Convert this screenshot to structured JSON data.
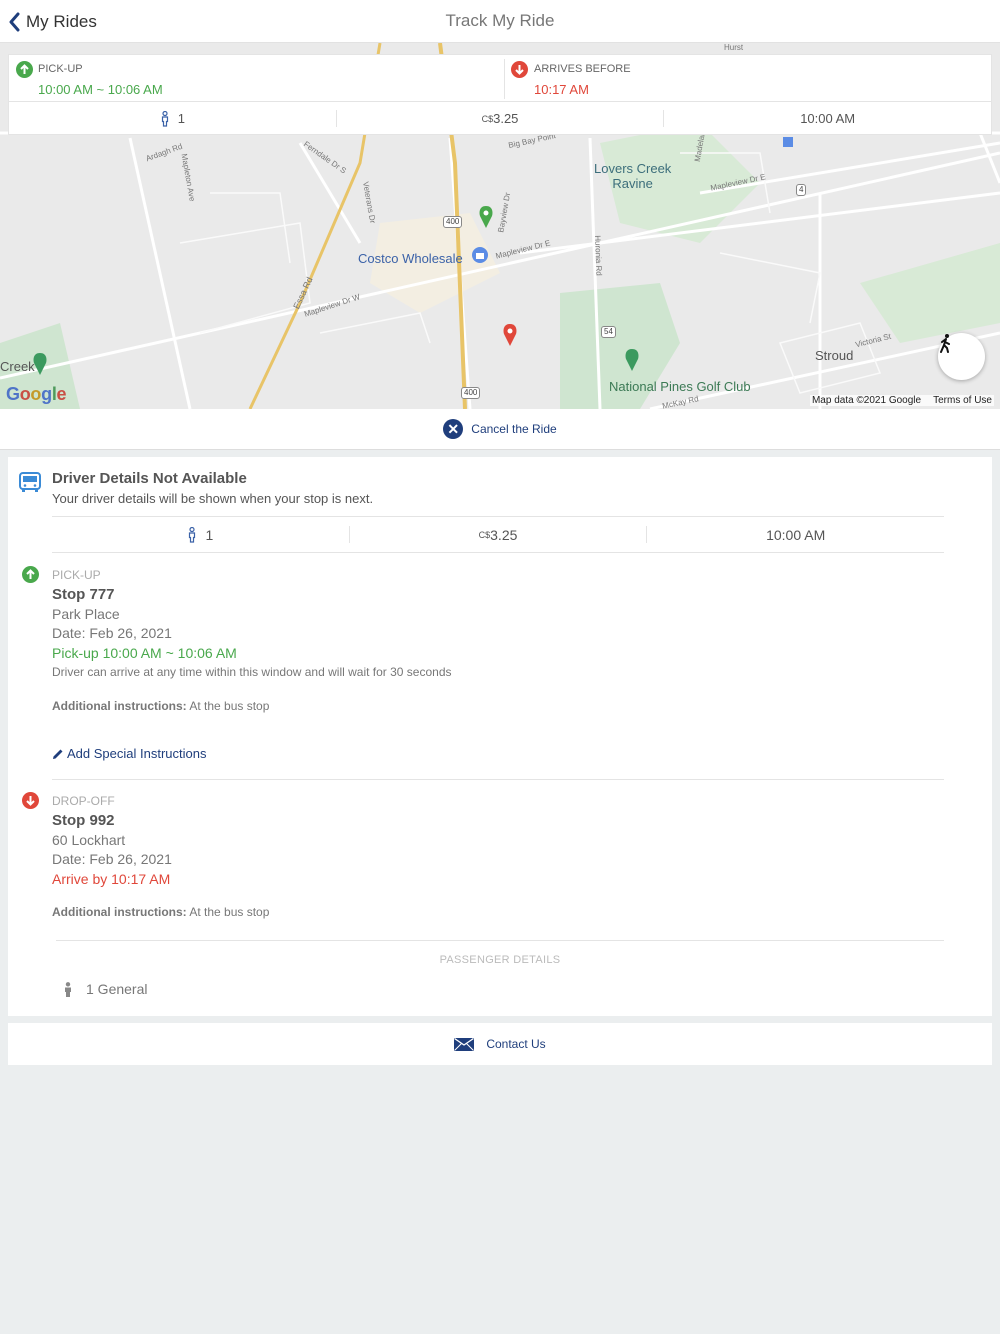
{
  "nav": {
    "back_label": "My Rides",
    "title": "Track My Ride"
  },
  "summary": {
    "pickup_label": "PICK-UP",
    "pickup_value": "10:00 AM ~ 10:06 AM",
    "arrives_label": "ARRIVES BEFORE",
    "arrives_value": "10:17 AM",
    "passengers": "1",
    "currency": "C$",
    "fare": "3.25",
    "time": "10:00 AM"
  },
  "map": {
    "places": {
      "lovers_creek": "Lovers Creek\nRavine",
      "costco": "Costco Wholesale",
      "stroud": "Stroud",
      "golf": "National Pines Golf Club",
      "creek": "Creek"
    },
    "roads": {
      "ardagh": "Ardagh Rd",
      "mapleton": "Mapleton Ave",
      "ferndale": "Ferndale Dr S",
      "veterans": "Veterans Dr",
      "bigbay": "Big Bay Point",
      "bayview": "Bayview Dr",
      "mapleview_e": "Mapleview Dr E",
      "mapleview_e2": "Mapleview Dr E",
      "mapleview_w": "Mapleview Dr W",
      "essa": "Essa Rd",
      "huronia": "Huronia Rd",
      "victoria": "Victoria St",
      "mckay": "McKay Rd",
      "madelaine": "Madelaine",
      "hurst": "Hurst"
    },
    "shields": [
      "400",
      "400",
      "54",
      "4"
    ],
    "google_logo": "Google",
    "attribution": "Map data ©2021 Google",
    "terms": "Terms of Use",
    "colors": {
      "pickup_pin": "#49a84c",
      "dropoff_pin": "#e0473a"
    }
  },
  "cancel_label": "Cancel the Ride",
  "driver": {
    "title": "Driver Details Not Available",
    "subtitle": "Your driver details will be shown when your stop is next."
  },
  "pickup": {
    "label": "PICK-UP",
    "stop": "Stop 777",
    "place": "Park Place",
    "date": "Date: Feb 26, 2021",
    "window": "Pick-up 10:00 AM ~ 10:06 AM",
    "note": "Driver can arrive at any time within this window and will wait for 30 seconds",
    "instr_label": "Additional instructions:",
    "instr_value": "At the bus stop",
    "add_special": "Add Special Instructions"
  },
  "dropoff": {
    "label": "DROP-OFF",
    "stop": "Stop 992",
    "place": "60 Lockhart",
    "date": "Date: Feb 26, 2021",
    "arrive": "Arrive by 10:17 AM",
    "instr_label": "Additional instructions:",
    "instr_value": "At the bus stop"
  },
  "passenger_details": {
    "label": "PASSENGER DETAILS",
    "entry": "1 General"
  },
  "contact_label": "Contact Us"
}
